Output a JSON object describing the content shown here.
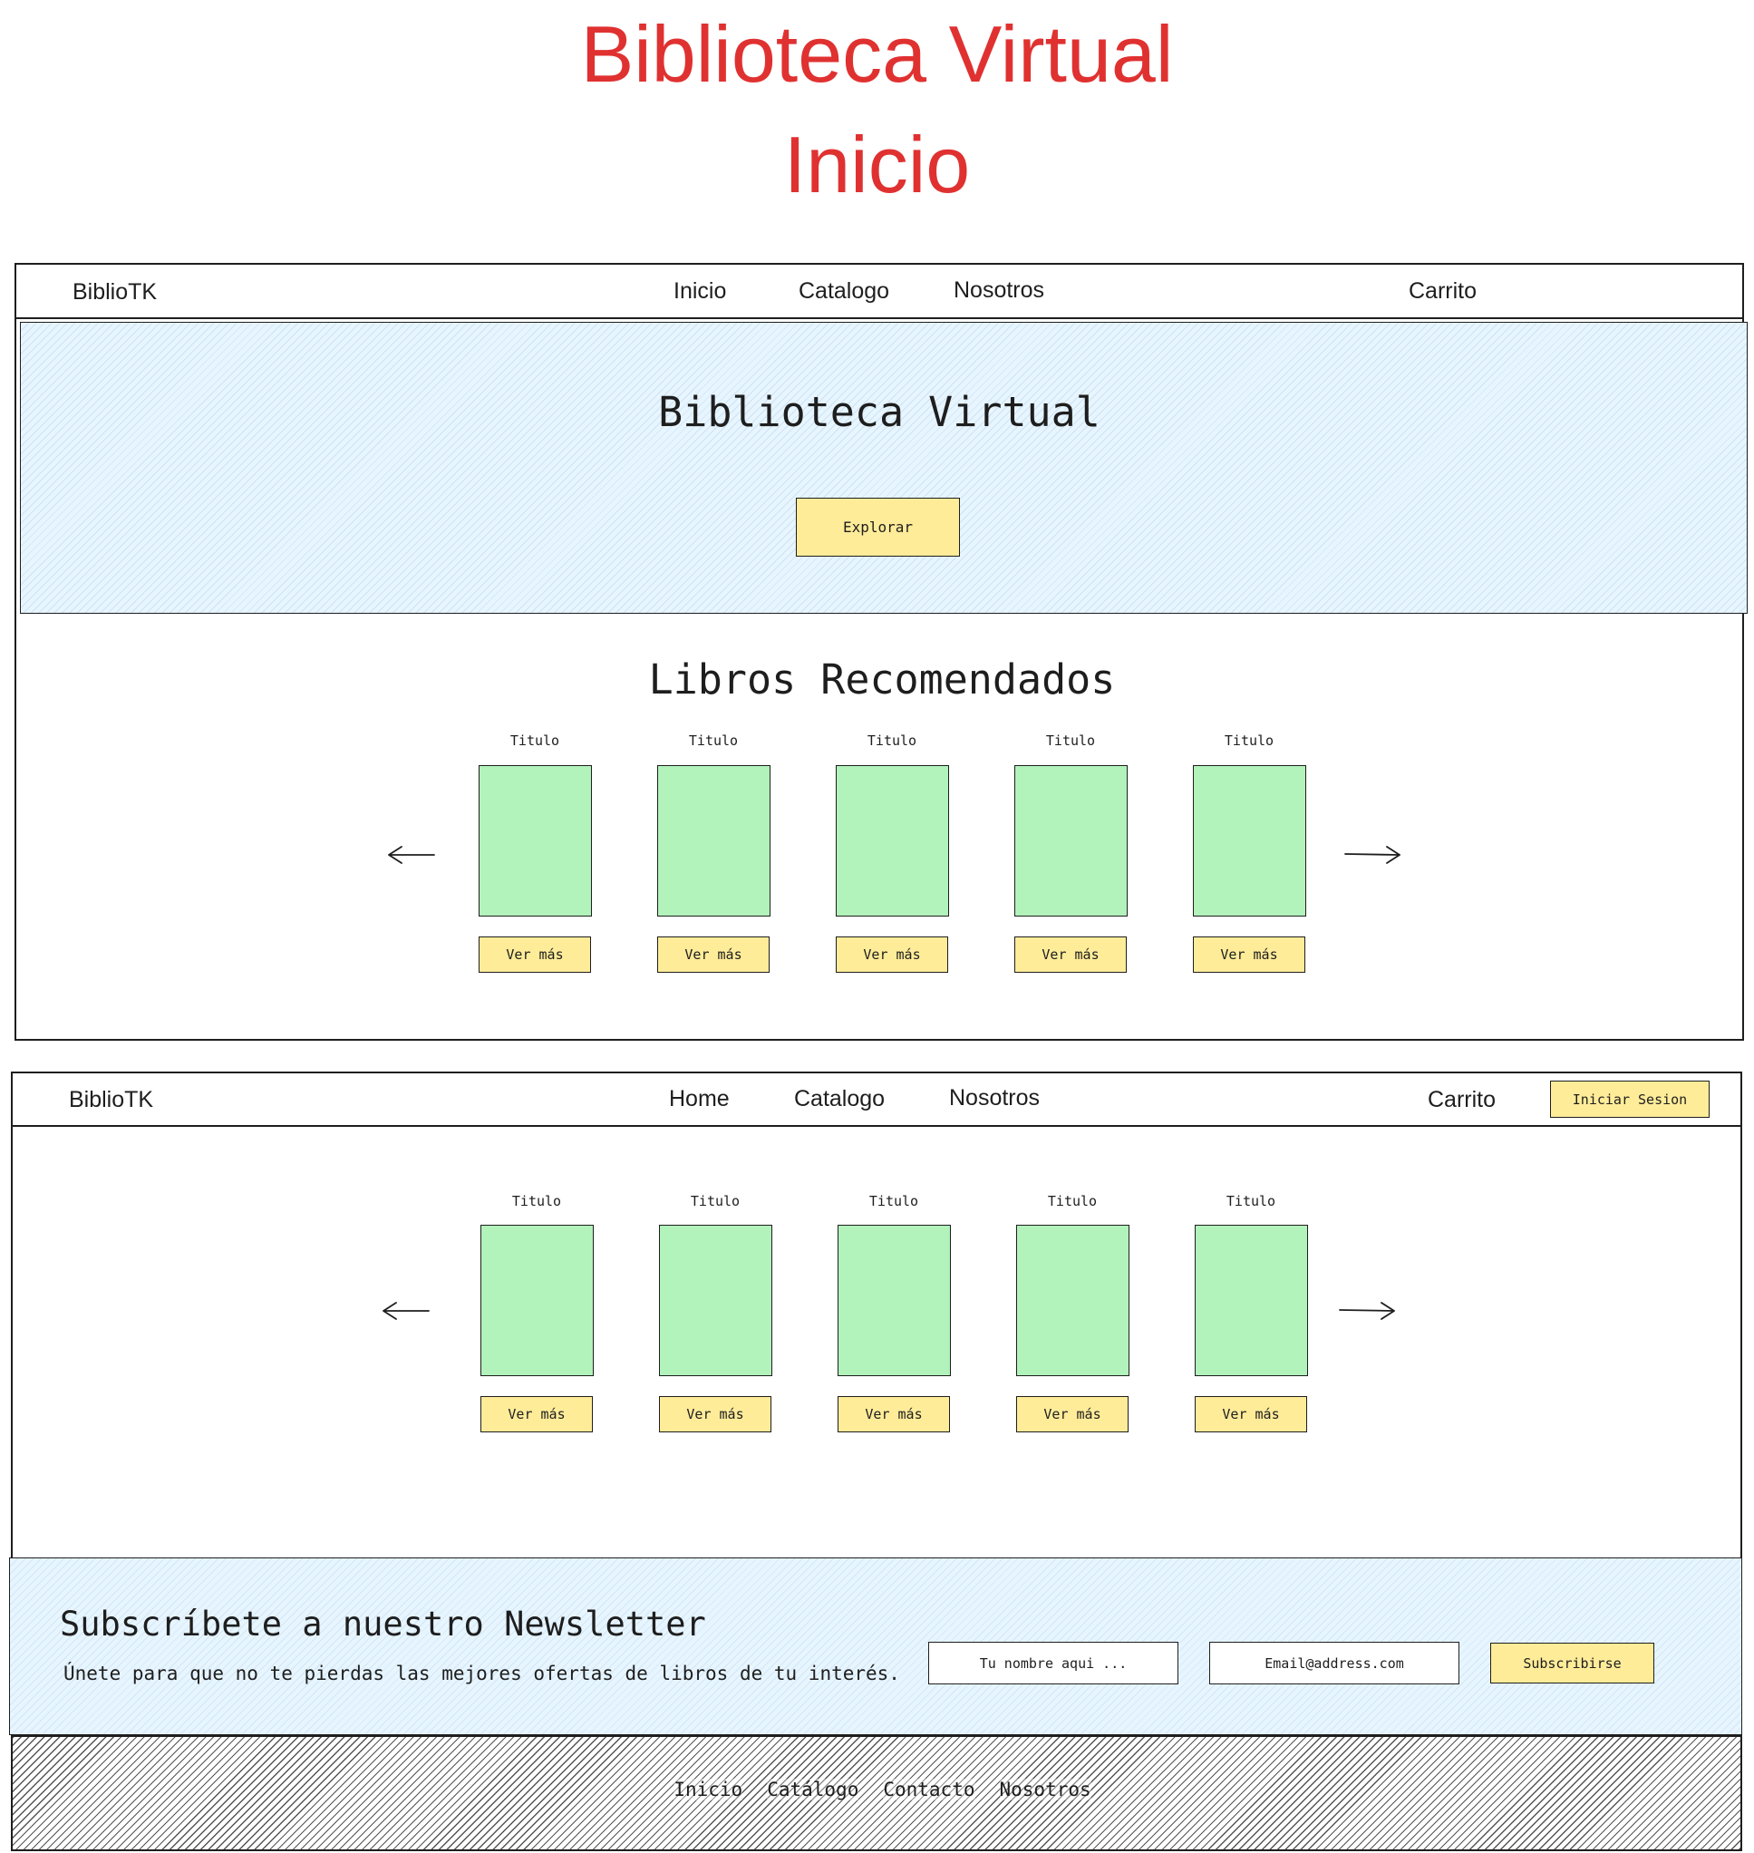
{
  "page": {
    "title_line1": "Biblioteca Virtual",
    "title_line2": "Inicio",
    "accent_color": "#e03131"
  },
  "wire1": {
    "nav": {
      "brand": "BiblioTK",
      "links": [
        "Inicio",
        "Catalogo",
        "Nosotros"
      ],
      "cart": "Carrito"
    },
    "hero": {
      "heading": "Biblioteca Virtual",
      "button": "Explorar"
    },
    "section_heading": "Libros Recomendados",
    "books": [
      {
        "title": "Titulo",
        "button": "Ver más"
      },
      {
        "title": "Titulo",
        "button": "Ver más"
      },
      {
        "title": "Titulo",
        "button": "Ver más"
      },
      {
        "title": "Titulo",
        "button": "Ver más"
      },
      {
        "title": "Titulo",
        "button": "Ver más"
      }
    ],
    "arrow_left": "arrow-left-icon",
    "arrow_right": "arrow-right-icon"
  },
  "wire2": {
    "nav": {
      "brand": "BiblioTK",
      "links": [
        "Home",
        "Catalogo",
        "Nosotros"
      ],
      "cart": "Carrito",
      "login": "Iniciar Sesion"
    },
    "books": [
      {
        "title": "Titulo",
        "button": "Ver más"
      },
      {
        "title": "Titulo",
        "button": "Ver más"
      },
      {
        "title": "Titulo",
        "button": "Ver más"
      },
      {
        "title": "Titulo",
        "button": "Ver más"
      },
      {
        "title": "Titulo",
        "button": "Ver más"
      }
    ],
    "newsletter": {
      "heading": "Subscríbete a nuestro Newsletter",
      "subtext": "Únete para que no te pierdas las mejores ofertas de libros de tu interés.",
      "name_placeholder": "Tu nombre aqui ...",
      "email_placeholder": "Email@address.com",
      "button": "Subscribirse"
    },
    "footer_links": [
      "Inicio",
      "Catálogo",
      "Contacto",
      "Nosotros"
    ]
  },
  "colors": {
    "book_fill": "#b2f2bb",
    "button_fill": "#ffec99",
    "hero_fill": "#e7f5ff"
  }
}
